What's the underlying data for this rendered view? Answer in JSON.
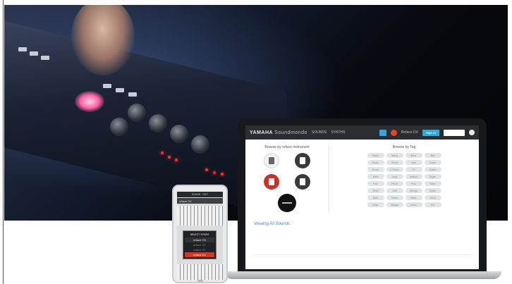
{
  "app": {
    "brand_bold": "YAMAHA",
    "brand_thin": "Soundmondo",
    "nav": [
      "SOUNDS",
      "SYNTHS"
    ],
    "header_buttons": [
      "",
      "Reface DX",
      "Sign In"
    ]
  },
  "browse": {
    "by_instrument_title": "Browse by reface instrument",
    "by_tag_title": "Browse by Tag",
    "instruments": [
      "reface CP",
      "reface YC",
      "reface DX",
      "reface CS"
    ],
    "tags": [
      "Attack",
      "Arpeg",
      "Bass",
      "Bell",
      "Brass",
      "Chord",
      "Clav",
      "Comp",
      "Drone",
      "E.Piano",
      "FX",
      "Guitar",
      "Hard",
      "Lead",
      "Mellow",
      "Organ",
      "Pad",
      "Pluck",
      "Poly",
      "Reed",
      "Short",
      "Soft",
      "Strings",
      "Synth",
      "Dark",
      "Warm",
      "Wide",
      "Wind",
      "Retro",
      "Vintage",
      "Mono",
      "Fat"
    ],
    "viewing_label": "Viewing All Sounds"
  },
  "phone": {
    "top_items": [
      "SOUND",
      "EDIT"
    ],
    "bar_label": "reface DX",
    "menu_title": "SELECT SYNTH",
    "menu_items": [
      "reface CS",
      "reface CP",
      "reface YC",
      "reface DX"
    ]
  },
  "colors": {
    "accent_blue": "#3fa0d8",
    "record_red": "#e0462b",
    "instrument_red": "#c8312a"
  }
}
